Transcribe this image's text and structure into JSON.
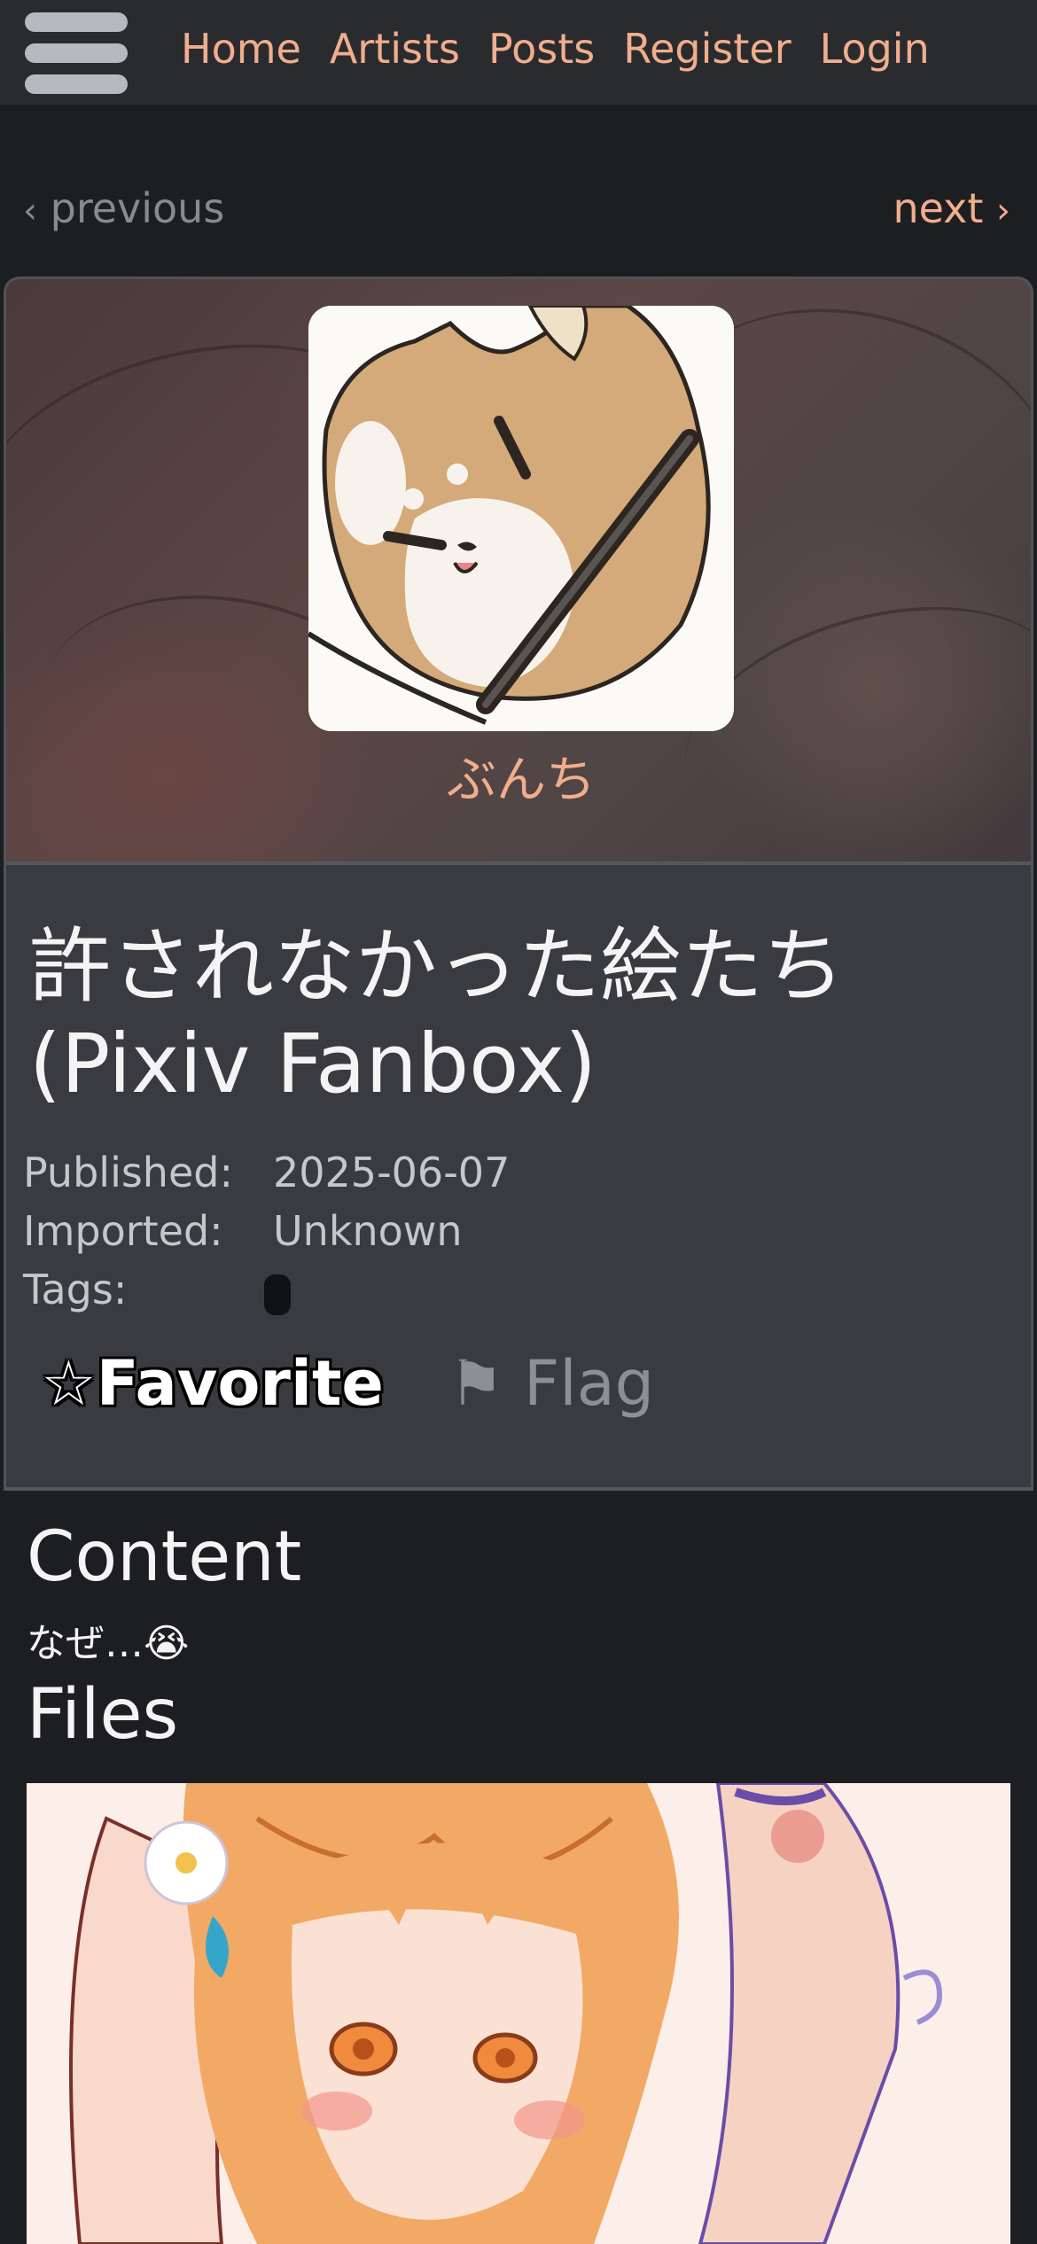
{
  "nav": {
    "menu_icon": "hamburger-menu-icon",
    "links": [
      "Home",
      "Artists",
      "Posts",
      "Register",
      "Login"
    ]
  },
  "pager": {
    "prev": "previous",
    "next": "next",
    "prev_chevron": "‹",
    "next_chevron": "›"
  },
  "artist": {
    "name": "ぶんち"
  },
  "post": {
    "title": "許されなかった絵たち (Pixiv Fanbox)",
    "meta": {
      "published_label": "Published:",
      "published_value": "2025-06-07",
      "imported_label": "Imported:",
      "imported_value": "Unknown",
      "tags_label": "Tags:"
    },
    "favorite_label": "☆Favorite",
    "flag_icon": "⚑",
    "flag_label": "Flag"
  },
  "body": {
    "content_heading": "Content",
    "content_text": "なぜ…😭",
    "files_heading": "Files"
  },
  "colors": {
    "accent": "#f0ae8c",
    "background": "#1d1e21",
    "topbar": "#2a2b2f",
    "panel": "#393b40"
  }
}
